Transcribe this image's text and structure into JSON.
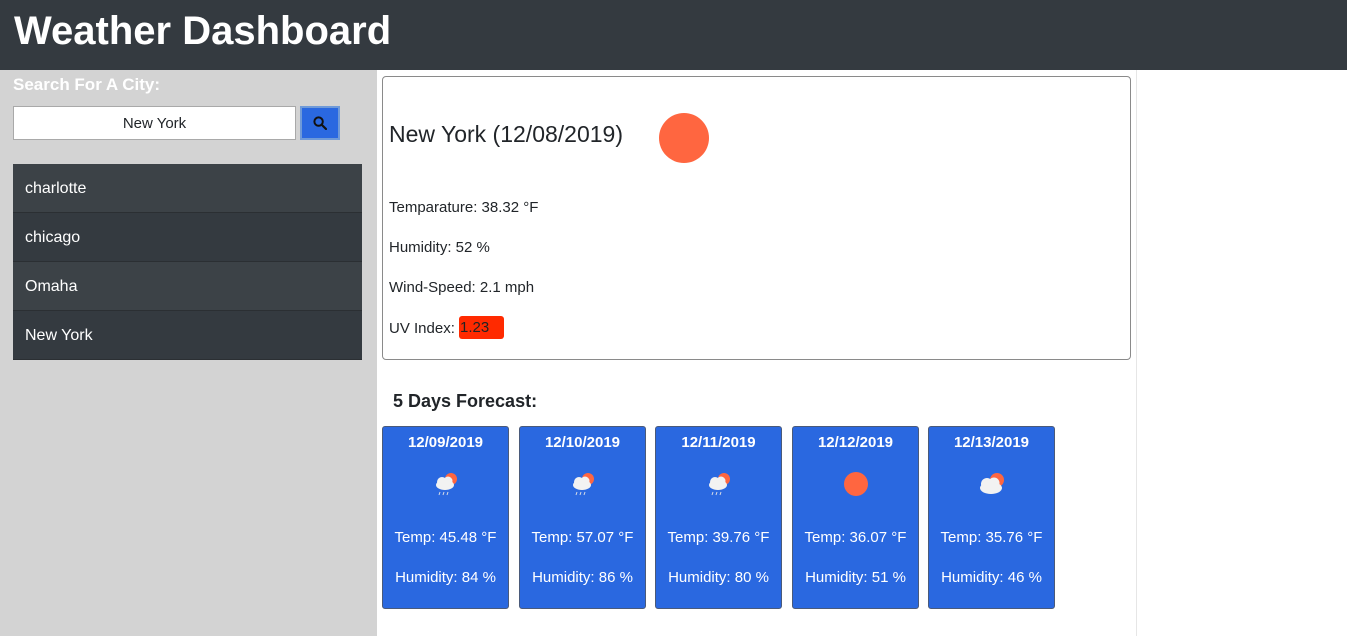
{
  "header": {
    "title": "Weather Dashboard"
  },
  "search": {
    "label": "Search For A City:",
    "value": "New York"
  },
  "history": [
    "charlotte",
    "chicago",
    "Omaha",
    "New York"
  ],
  "current": {
    "title": "New York (12/08/2019)",
    "icon": "sun-icon",
    "temperature": "Temparature: 38.32 °F",
    "humidity": "Humidity: 52 %",
    "wind": "Wind-Speed: 2.1 mph",
    "uv_label": "UV Index: ",
    "uv_value": "1.23",
    "uv_color": "#ff2a00"
  },
  "forecast": {
    "title": "5 Days Forecast:",
    "days": [
      {
        "date": "12/09/2019",
        "icon": "rain-cloud-sun-icon",
        "temp": "Temp: 45.48 °F",
        "humidity": "Humidity: 84 %"
      },
      {
        "date": "12/10/2019",
        "icon": "rain-cloud-sun-icon",
        "temp": "Temp: 57.07 °F",
        "humidity": "Humidity: 86 %"
      },
      {
        "date": "12/11/2019",
        "icon": "rain-cloud-sun-icon",
        "temp": "Temp: 39.76 °F",
        "humidity": "Humidity: 80 %"
      },
      {
        "date": "12/12/2019",
        "icon": "sun-icon",
        "temp": "Temp: 36.07 °F",
        "humidity": "Humidity: 51 %"
      },
      {
        "date": "12/13/2019",
        "icon": "cloud-sun-icon",
        "temp": "Temp: 35.76 °F",
        "humidity": "Humidity: 46 %"
      }
    ]
  },
  "colors": {
    "header_bg": "#343a40",
    "sidebar_bg": "#d3d3d3",
    "card_bg": "#2a68e0",
    "sun": "#ff6640"
  }
}
